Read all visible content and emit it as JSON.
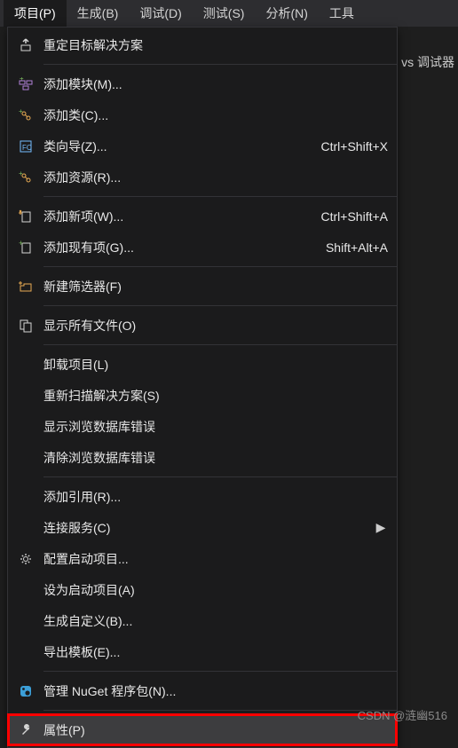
{
  "menubar": {
    "items": [
      {
        "label": "项目(P)",
        "active": true
      },
      {
        "label": "生成(B)",
        "active": false
      },
      {
        "label": "调试(D)",
        "active": false
      },
      {
        "label": "测试(S)",
        "active": false
      },
      {
        "label": "分析(N)",
        "active": false
      },
      {
        "label": "工具",
        "active": false
      }
    ]
  },
  "background": {
    "text": "vs 调试器"
  },
  "dropdown": {
    "sections": [
      [
        {
          "icon": "retarget-icon",
          "label": "重定目标解决方案",
          "shortcut": "",
          "submenu": false
        }
      ],
      [
        {
          "icon": "add-module-icon",
          "label": "添加模块(M)...",
          "shortcut": "",
          "submenu": false
        },
        {
          "icon": "add-class-icon",
          "label": "添加类(C)...",
          "shortcut": "",
          "submenu": false
        },
        {
          "icon": "class-wizard-icon",
          "label": "类向导(Z)...",
          "shortcut": "Ctrl+Shift+X",
          "submenu": false
        },
        {
          "icon": "add-resource-icon",
          "label": "添加资源(R)...",
          "shortcut": "",
          "submenu": false
        }
      ],
      [
        {
          "icon": "new-item-icon",
          "label": "添加新项(W)...",
          "shortcut": "Ctrl+Shift+A",
          "submenu": false
        },
        {
          "icon": "existing-item-icon",
          "label": "添加现有项(G)...",
          "shortcut": "Shift+Alt+A",
          "submenu": false
        }
      ],
      [
        {
          "icon": "new-filter-icon",
          "label": "新建筛选器(F)",
          "shortcut": "",
          "submenu": false
        }
      ],
      [
        {
          "icon": "show-all-icon",
          "label": "显示所有文件(O)",
          "shortcut": "",
          "submenu": false
        }
      ],
      [
        {
          "icon": "",
          "label": "卸载项目(L)",
          "shortcut": "",
          "submenu": false
        },
        {
          "icon": "",
          "label": "重新扫描解决方案(S)",
          "shortcut": "",
          "submenu": false
        },
        {
          "icon": "",
          "label": "显示浏览数据库错误",
          "shortcut": "",
          "submenu": false
        },
        {
          "icon": "",
          "label": "清除浏览数据库错误",
          "shortcut": "",
          "submenu": false
        }
      ],
      [
        {
          "icon": "",
          "label": "添加引用(R)...",
          "shortcut": "",
          "submenu": false
        },
        {
          "icon": "",
          "label": "连接服务(C)",
          "shortcut": "",
          "submenu": true
        },
        {
          "icon": "gear-icon",
          "label": "配置启动项目...",
          "shortcut": "",
          "submenu": false
        },
        {
          "icon": "",
          "label": "设为启动项目(A)",
          "shortcut": "",
          "submenu": false
        },
        {
          "icon": "",
          "label": "生成自定义(B)...",
          "shortcut": "",
          "submenu": false
        },
        {
          "icon": "",
          "label": "导出模板(E)...",
          "shortcut": "",
          "submenu": false
        }
      ],
      [
        {
          "icon": "nuget-icon",
          "label": "管理 NuGet 程序包(N)...",
          "shortcut": "",
          "submenu": false
        }
      ],
      [
        {
          "icon": "wrench-icon",
          "label": "属性(P)",
          "shortcut": "",
          "submenu": false,
          "highlight": true
        }
      ]
    ]
  },
  "watermark": "CSDN @涟幽516"
}
